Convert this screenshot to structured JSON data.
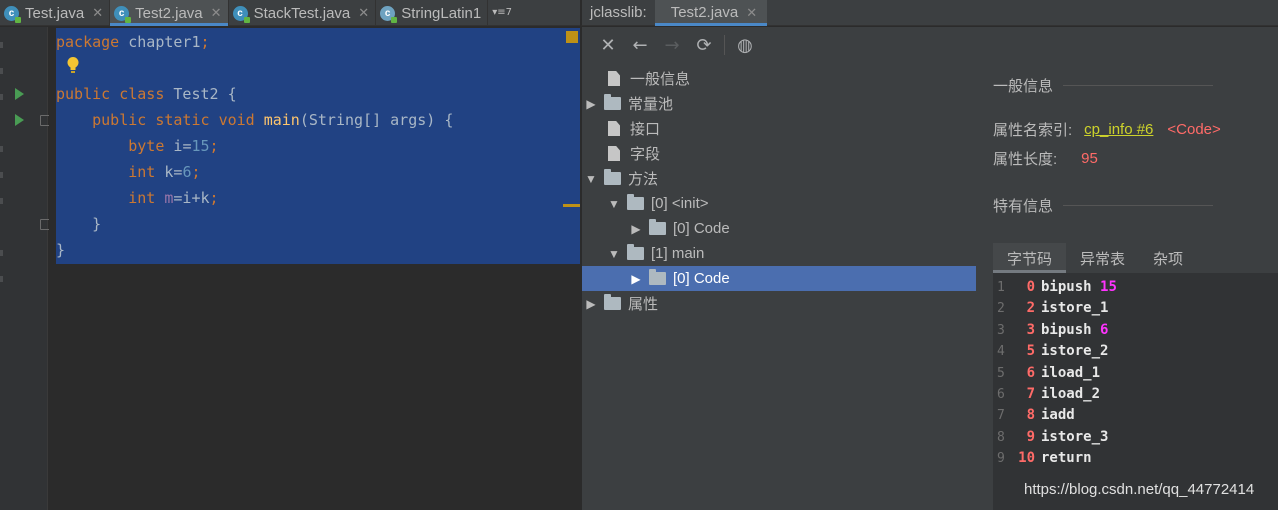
{
  "editor": {
    "tabs": [
      {
        "label": "Test.java",
        "close": "✕"
      },
      {
        "label": "Test2.java",
        "close": "✕"
      },
      {
        "label": "StackTest.java",
        "close": "✕"
      },
      {
        "label": "StringLatin1",
        "close": ""
      }
    ],
    "overflow_label": "▾≡7",
    "code": {
      "l1_kw": "package",
      "l1_rest": " chapter1",
      "l1_semi": ";",
      "l3_kw1": "public",
      "l3_kw2": "class",
      "l3_name": "Test2",
      "l3_brace": " {",
      "l4_kw1": "public",
      "l4_kw2": "static",
      "l4_kw3": "void",
      "l4_fn": "main",
      "l4_rest": "(String[] args) {",
      "l5_kw": "byte",
      "l5_var": "i",
      "l5_eq": "=",
      "l5_num": "15",
      "l5_semi": ";",
      "l6_kw": "int",
      "l6_var": "k",
      "l6_eq": "=",
      "l6_num": "6",
      "l6_semi": ";",
      "l7_kw": "int",
      "l7_var": "m",
      "l7_rest": "=i+k",
      "l7_semi": ";",
      "l8": "}",
      "l9": "}"
    }
  },
  "jclasslib": {
    "title": "jclasslib:",
    "tab": "Test2.java",
    "tab_close": "✕",
    "toolbar": {
      "close": "✕",
      "back": "←",
      "forward": "→",
      "refresh": "⟳",
      "web": "◍"
    },
    "tree": {
      "general": "一般信息",
      "constant_pool": "常量池",
      "interfaces": "接口",
      "fields": "字段",
      "methods": "方法",
      "init": "[0] <init>",
      "init_code": "[0] Code",
      "main": "[1] main",
      "main_code": "[0] Code",
      "attributes": "属性"
    },
    "detail": {
      "general_title": "一般信息",
      "attr_name_label": "属性名索引:",
      "attr_name_link": "cp_info #6",
      "attr_name_value": "<Code>",
      "attr_len_label": "属性长度:",
      "attr_len_value": "95",
      "specific_title": "特有信息",
      "sub_tabs": [
        "字节码",
        "异常表",
        "杂项"
      ]
    },
    "bytecode": [
      {
        "line": "1",
        "offset": "0",
        "op": "bipush",
        "arg": "15"
      },
      {
        "line": "2",
        "offset": "2",
        "op": "istore_1",
        "arg": ""
      },
      {
        "line": "3",
        "offset": "3",
        "op": "bipush",
        "arg": "6"
      },
      {
        "line": "4",
        "offset": "5",
        "op": "istore_2",
        "arg": ""
      },
      {
        "line": "5",
        "offset": "6",
        "op": "iload_1",
        "arg": ""
      },
      {
        "line": "6",
        "offset": "7",
        "op": "iload_2",
        "arg": ""
      },
      {
        "line": "7",
        "offset": "8",
        "op": "iadd",
        "arg": ""
      },
      {
        "line": "8",
        "offset": "9",
        "op": "istore_3",
        "arg": ""
      },
      {
        "line": "9",
        "offset": "10",
        "op": "return",
        "arg": ""
      }
    ]
  },
  "watermark": "https://blog.csdn.net/qq_44772414"
}
